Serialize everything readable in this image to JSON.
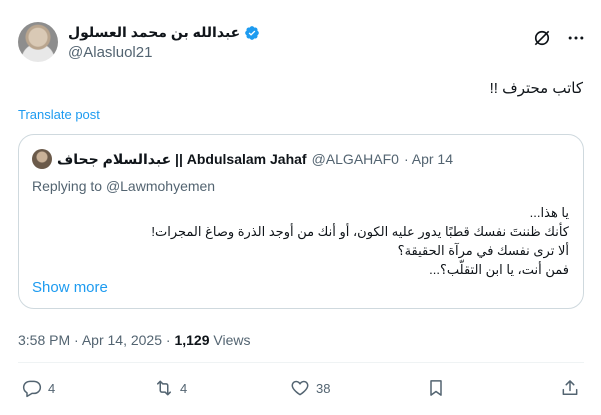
{
  "author": {
    "name": "عبدالله بن محمد العسلول",
    "handle": "@Alasluol21",
    "avatar": "user-avatar"
  },
  "tweet": {
    "text": "كاتب محترف !!",
    "translate_label": "Translate post"
  },
  "quote": {
    "author_name": "عبدالسلام جحاف || Abdulsalam Jahaf",
    "handle": "@ALGAHAF0",
    "date": "· Apr 14",
    "replying_prefix": "Replying to",
    "replying_handle": "@Lawmohyemen",
    "body_lines": [
      "يا هذا...",
      "كأنك ظننتَ نفسك قطبًا يدور عليه الكون، أو أنك من أوجد الذرة وصاغ المجرات!",
      "ألا ترى نفسك في مرآة الحقيقة؟",
      "فمن أنت، يا ابن التقلّب؟..."
    ],
    "show_more": "Show more"
  },
  "meta": {
    "time": "3:58 PM",
    "date": "Apr 14, 2025",
    "views_count": "1,129",
    "views_label": "Views"
  },
  "actions": {
    "replies": "4",
    "reposts": "4",
    "likes": "38"
  },
  "colors": {
    "accent": "#1d9bf0",
    "muted": "#536471",
    "text": "#0f1419",
    "border": "#cfd9de"
  }
}
